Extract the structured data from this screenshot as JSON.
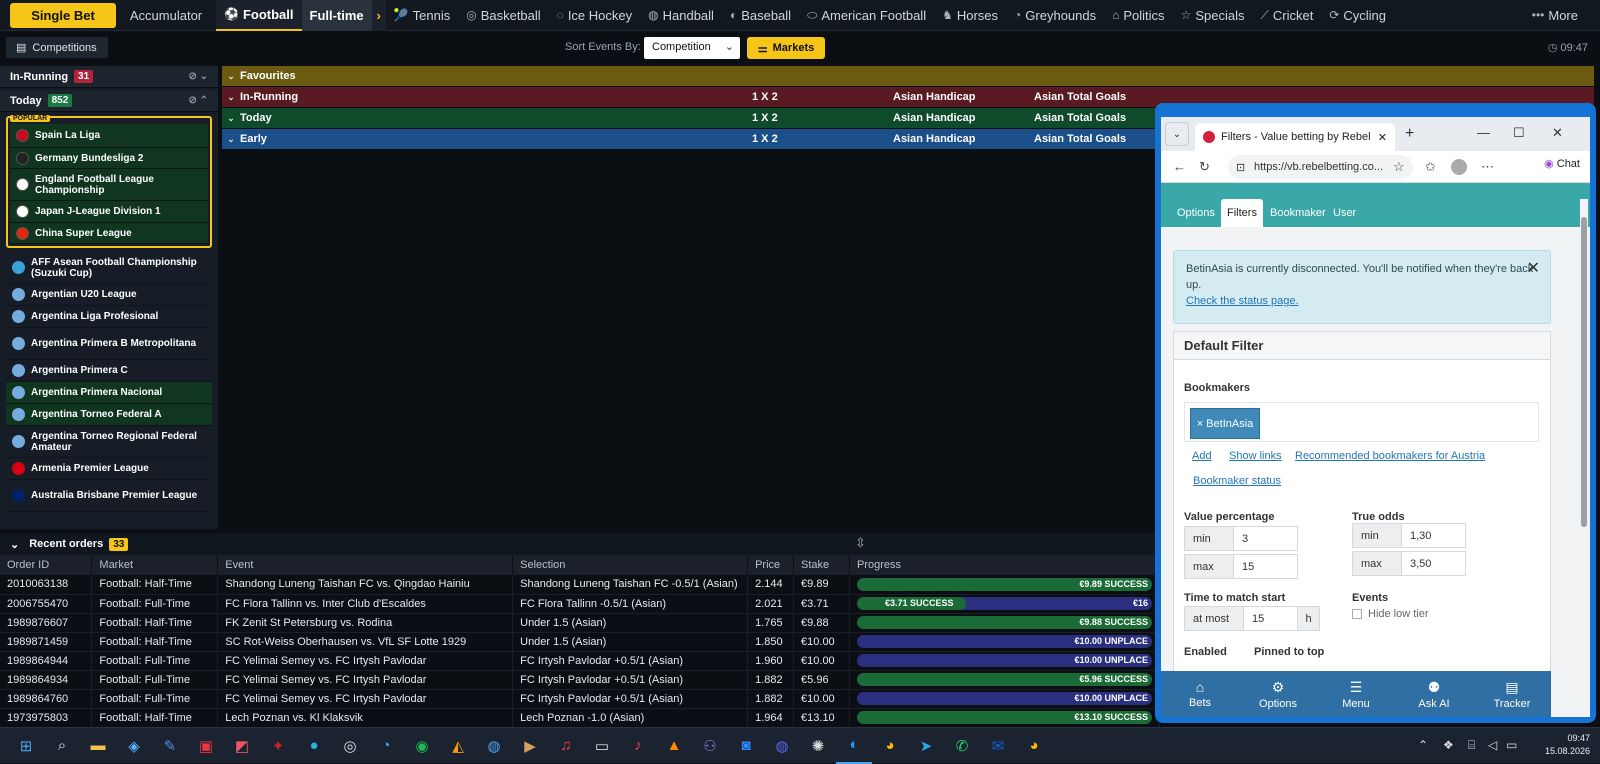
{
  "topnav": {
    "single_bet": "Single Bet",
    "accumulator": "Accumulator",
    "sports": [
      "Football",
      "Tennis",
      "Basketball",
      "Ice Hockey",
      "Handball",
      "Baseball",
      "American Football",
      "Horses",
      "Greyhounds",
      "Politics",
      "Specials",
      "Cricket",
      "Cycling"
    ],
    "sub": "Full-time",
    "more": "More"
  },
  "bar2": {
    "competitions": "Competitions",
    "sort_label": "Sort Events By:",
    "sort_value": "Competition",
    "markets": "Markets",
    "time": "09:47"
  },
  "sidebar": {
    "in_running": {
      "label": "In-Running",
      "count": "31"
    },
    "today": {
      "label": "Today",
      "count": "852"
    },
    "popular_tag": "POPULAR",
    "popular": [
      {
        "name": "Spain La Liga",
        "flag": "#c60b1e"
      },
      {
        "name": "Germany Bundesliga 2",
        "flag": "#222222"
      },
      {
        "name": "England Football League Championship",
        "flag": "#ffffff"
      },
      {
        "name": "Japan J-League Division 1",
        "flag": "#ffffff"
      },
      {
        "name": "China Super League",
        "flag": "#de2910"
      }
    ],
    "leagues": [
      {
        "name": "AFF Asean Football Championship (Suzuki Cup)",
        "flag": "#3aa0d8",
        "green": false
      },
      {
        "name": "Argentian U20 League",
        "flag": "#74acdf",
        "green": false
      },
      {
        "name": "Argentina Liga Profesional",
        "flag": "#74acdf",
        "green": false
      },
      {
        "name": "Argentina Primera B Metropolitana",
        "flag": "#74acdf",
        "green": false
      },
      {
        "name": "Argentina Primera C",
        "flag": "#74acdf",
        "green": false
      },
      {
        "name": "Argentina Primera Nacional",
        "flag": "#74acdf",
        "green": true
      },
      {
        "name": "Argentina Torneo Federal A",
        "flag": "#74acdf",
        "green": true
      },
      {
        "name": "Argentina Torneo Regional Federal Amateur",
        "flag": "#74acdf",
        "green": false
      },
      {
        "name": "Armenia Premier League",
        "flag": "#d90012",
        "green": false
      },
      {
        "name": "Australia Brisbane Premier League",
        "flag": "#012169",
        "green": false
      }
    ]
  },
  "groups": {
    "favourites": "Favourites",
    "in_running": "In-Running",
    "today": "Today",
    "early": "Early",
    "col_1x2": "1 X 2",
    "col_ah": "Asian Handicap",
    "col_atg": "Asian Total Goals"
  },
  "orders": {
    "title": "Recent orders",
    "count": "33",
    "headers": [
      "Order ID",
      "Market",
      "Event",
      "Selection",
      "Price",
      "Stake",
      "Progress"
    ],
    "rows": [
      {
        "id": "2010063138",
        "market": "Football: Half-Time",
        "event": "Shandong Luneng Taishan FC vs. Qingdao Hainiu",
        "selection": "Shandong Luneng Taishan FC -0.5/1 (Asian)",
        "price": "2.144",
        "stake": "€9.89",
        "progress": "€9.89 SUCCESS",
        "fill": 1.0
      },
      {
        "id": "2006755470",
        "market": "Football: Full-Time",
        "event": "FC Flora Tallinn vs. Inter Club d'Escaldes",
        "selection": "FC Flora Tallinn -0.5/1 (Asian)",
        "price": "2.021",
        "stake": "€3.71",
        "progress": "€3.71 SUCCESS",
        "progress2": "€16",
        "fill": 0.37
      },
      {
        "id": "1989876607",
        "market": "Football: Half-Time",
        "event": "FK Zenit St Petersburg vs. Rodina",
        "selection": "Under 1.5 (Asian)",
        "price": "1.765",
        "stake": "€9.88",
        "progress": "€9.88 SUCCESS",
        "fill": 1.0
      },
      {
        "id": "1989871459",
        "market": "Football: Half-Time",
        "event": "SC Rot-Weiss Oberhausen vs. VfL SF Lotte 1929",
        "selection": "Under 1.5 (Asian)",
        "price": "1.850",
        "stake": "€10.00",
        "progress": "€10.00 UNPLACE",
        "fill": 0.0
      },
      {
        "id": "1989864944",
        "market": "Football: Full-Time",
        "event": "FC Yelimai Semey vs. FC Irtysh Pavlodar",
        "selection": "FC Irtysh Pavlodar +0.5/1 (Asian)",
        "price": "1.960",
        "stake": "€10.00",
        "progress": "€10.00 UNPLACE",
        "fill": 0.0
      },
      {
        "id": "1989864934",
        "market": "Football: Full-Time",
        "event": "FC Yelimai Semey vs. FC Irtysh Pavlodar",
        "selection": "FC Irtysh Pavlodar +0.5/1 (Asian)",
        "price": "1.882",
        "stake": "€5.96",
        "progress": "€5.96 SUCCESS",
        "fill": 1.0
      },
      {
        "id": "1989864760",
        "market": "Football: Full-Time",
        "event": "FC Yelimai Semey vs. FC Irtysh Pavlodar",
        "selection": "FC Irtysh Pavlodar +0.5/1 (Asian)",
        "price": "1.882",
        "stake": "€10.00",
        "progress": "€10.00 UNPLACE",
        "fill": 0.0
      },
      {
        "id": "1973975803",
        "market": "Football: Half-Time",
        "event": "Lech Poznan vs. Kl Klaksvik",
        "selection": "Lech Poznan -1.0 (Asian)",
        "price": "1.964",
        "stake": "€13.10",
        "progress": "€13.10 SUCCESS",
        "fill": 1.0
      }
    ]
  },
  "browser": {
    "tab_title": "Filters - Value betting by RebelBetti",
    "url": "https://vb.rebelbetting.co...",
    "chat": "Chat",
    "tabs": [
      "Options",
      "Filters",
      "Bookmaker",
      "User"
    ],
    "alert_text": "BetinAsia is currently disconnected. You'll be notified when they're back up.",
    "alert_link": "Check the status page.",
    "card_title": "Default Filter",
    "bookmakers_label": "Bookmakers",
    "bookmaker_chip": "× BetInAsia",
    "links": [
      "Add",
      "Show links",
      "Recommended bookmakers for Austria",
      "Bookmaker status"
    ],
    "value_pct_label": "Value percentage",
    "value_min_label": "min",
    "value_min": "3",
    "value_max_label": "max",
    "value_max": "15",
    "true_odds_label": "True odds",
    "odds_min_label": "min",
    "odds_min": "1,30",
    "odds_max_label": "max",
    "odds_max": "3,50",
    "time_label": "Time to match start",
    "time_atmost_label": "at most",
    "time_value": "15",
    "time_unit": "h",
    "events_label": "Events",
    "hide_low_tier": "Hide low tier",
    "enabled_label": "Enabled",
    "pinned_label": "Pinned to top",
    "bottom_nav": [
      "Bets",
      "Options",
      "Menu",
      "Ask AI",
      "Tracker"
    ]
  },
  "taskbar": {
    "time": "09:47",
    "date": "15.08.2026"
  },
  "colors": {
    "accent": "#f5c518",
    "favourites_bar": "#6b5b10",
    "inrunning_bar": "#5a1a22",
    "today_bar": "#0f4a2b",
    "early_bar": "#1a4f8a"
  }
}
